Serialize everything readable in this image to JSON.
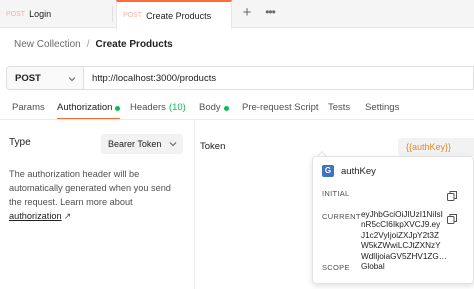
{
  "tabs": [
    {
      "method": "POST",
      "name": "Login"
    },
    {
      "method": "POST",
      "name": "Create Products"
    }
  ],
  "tab_actions": {
    "new_tab": "+",
    "more": "•••"
  },
  "breadcrumb": {
    "parent": "New Collection",
    "separator": "/",
    "current": "Create Products"
  },
  "request": {
    "method": "POST",
    "url": "http://localhost:3000/products"
  },
  "request_tabs": {
    "params": "Params",
    "authorization": "Authorization",
    "headers": "Headers",
    "headers_count": "(10)",
    "body": "Body",
    "pre_request_script": "Pre-request Script",
    "tests": "Tests",
    "settings": "Settings"
  },
  "auth": {
    "type_label": "Type",
    "type_value": "Bearer Token",
    "help_text": "The authorization header will be automatically generated when you send the request. Learn more about ",
    "help_link": "authorization",
    "help_arrow": "↗",
    "token_label": "Token",
    "token_value": "{{authKey}}"
  },
  "popover": {
    "badge": "G",
    "title": "authKey",
    "initial_label": "INITIAL",
    "current_label": "CURRENT",
    "current_value_lines": [
      "eyJhbGciOiJIUzI1NiIsI",
      "nR5cCI6IkpXVCJ9.ey",
      "J1c2VyIjoiZXJpY2t3Z",
      "W5kZWwiLCJtZXNzY",
      "WdlIjoiaGV5ZHV1ZG…"
    ],
    "scope_label": "SCOPE",
    "scope_value": "Global"
  },
  "colors": {
    "accent": "#ff6c37",
    "status_green": "#0cbb52",
    "variable_orange": "#e08a2c",
    "global_badge": "#3d73c4"
  }
}
